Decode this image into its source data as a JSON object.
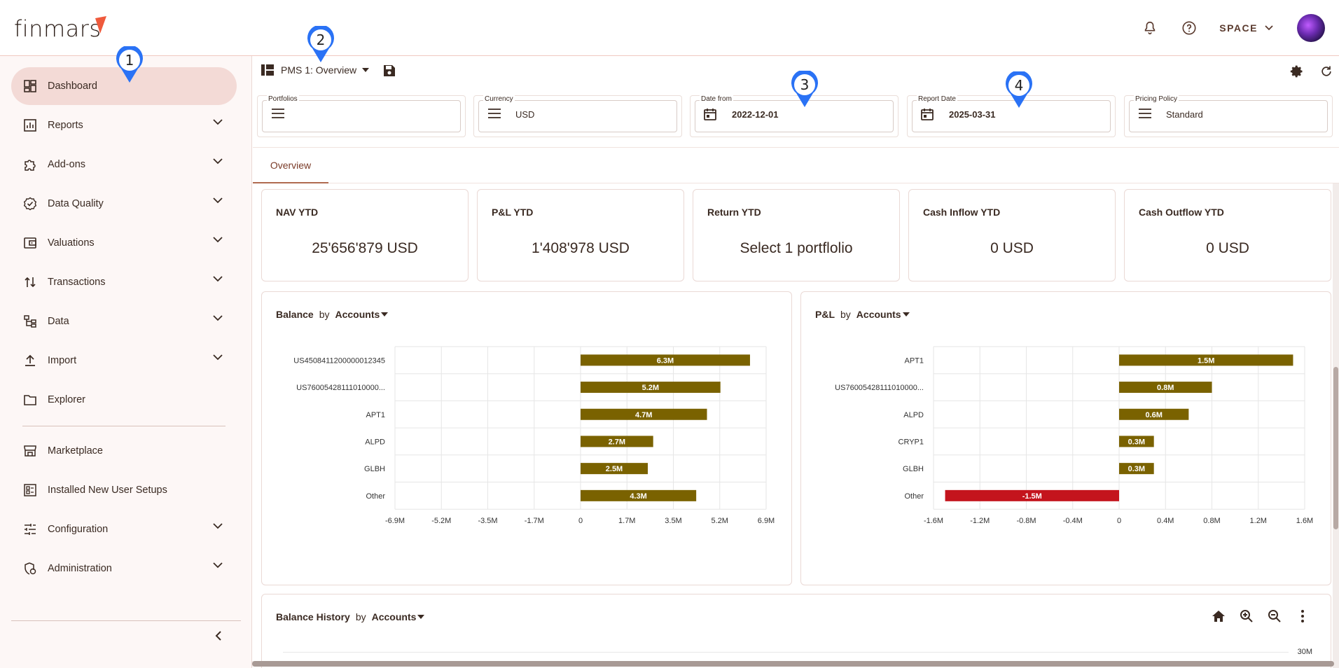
{
  "app": {
    "logo_text": "finmars",
    "space_label": "SPACE"
  },
  "sidebar": {
    "items": [
      {
        "label": "Dashboard",
        "icon": "dashboard-icon",
        "active": true
      },
      {
        "label": "Reports",
        "icon": "chart-icon"
      },
      {
        "label": "Add-ons",
        "icon": "puzzle-icon"
      },
      {
        "label": "Data Quality",
        "icon": "badge-check-icon"
      },
      {
        "label": "Valuations",
        "icon": "wallet-icon"
      },
      {
        "label": "Transactions",
        "icon": "arrows-updown-icon"
      },
      {
        "label": "Data",
        "icon": "tree-icon"
      },
      {
        "label": "Import",
        "icon": "upload-icon"
      },
      {
        "label": "Explorer",
        "icon": "folder-icon"
      },
      {
        "label": "Marketplace",
        "icon": "store-icon"
      },
      {
        "label": "Installed New User Setups",
        "icon": "setups-icon"
      },
      {
        "label": "Configuration",
        "icon": "sliders-icon"
      },
      {
        "label": "Administration",
        "icon": "admin-icon"
      }
    ]
  },
  "toolbar": {
    "layout_name": "PMS 1: Overview"
  },
  "filters": {
    "portfolios": {
      "label": "Portfolios",
      "value": ""
    },
    "currency": {
      "label": "Currency",
      "value": "USD"
    },
    "date_from": {
      "label": "Date from",
      "value": "2022-12-01"
    },
    "report_date": {
      "label": "Report Date",
      "value": "2025-03-31"
    },
    "pricing_policy": {
      "label": "Pricing Policy",
      "value": "Standard"
    }
  },
  "tabs": [
    {
      "label": "Overview",
      "active": true
    }
  ],
  "kpis": [
    {
      "title": "NAV YTD",
      "value": "25'656'879 USD"
    },
    {
      "title": "P&L YTD",
      "value": "1'408'978 USD"
    },
    {
      "title": "Return YTD",
      "value": "Select 1 portflolio"
    },
    {
      "title": "Cash Inflow YTD",
      "value": "0 USD"
    },
    {
      "title": "Cash Outflow YTD",
      "value": "0 USD"
    }
  ],
  "balance_panel": {
    "title": "Balance",
    "by": "by",
    "group": "Accounts"
  },
  "pl_panel": {
    "title": "P&L",
    "by": "by",
    "group": "Accounts"
  },
  "history_panel": {
    "title": "Balance History",
    "by": "by",
    "group": "Accounts",
    "y_tick": "30M"
  },
  "markers": [
    "1",
    "2",
    "3",
    "4"
  ],
  "colors": {
    "positive_bar": "#7a6200",
    "negative_bar": "#c4141d",
    "accent": "#7a3b28"
  },
  "chart_data": [
    {
      "type": "bar",
      "orientation": "horizontal",
      "title": "Balance",
      "categories": [
        "US4508411200000012345",
        "US76005428111010000...",
        "APT1",
        "ALPD",
        "GLBH",
        "Other"
      ],
      "values": [
        6.3,
        5.2,
        4.7,
        2.7,
        2.5,
        4.3
      ],
      "data_labels": [
        "6.3M",
        "5.2M",
        "4.7M",
        "2.7M",
        "2.5M",
        "4.3M"
      ],
      "x_ticks": [
        "-6.9M",
        "-5.2M",
        "-3.5M",
        "-1.7M",
        "0",
        "1.7M",
        "3.5M",
        "5.2M",
        "6.9M"
      ],
      "xlim": [
        -6.9,
        6.9
      ]
    },
    {
      "type": "bar",
      "orientation": "horizontal",
      "title": "P&L",
      "categories": [
        "APT1",
        "US76005428111010000...",
        "ALPD",
        "CRYP1",
        "GLBH",
        "Other"
      ],
      "values": [
        1.5,
        0.8,
        0.6,
        0.3,
        0.3,
        -1.5
      ],
      "data_labels": [
        "1.5M",
        "0.8M",
        "0.6M",
        "0.3M",
        "0.3M",
        "-1.5M"
      ],
      "x_ticks": [
        "-1.6M",
        "-1.2M",
        "-0.8M",
        "-0.4M",
        "0",
        "0.4M",
        "0.8M",
        "1.2M",
        "1.6M"
      ],
      "xlim": [
        -1.6,
        1.6
      ]
    }
  ]
}
